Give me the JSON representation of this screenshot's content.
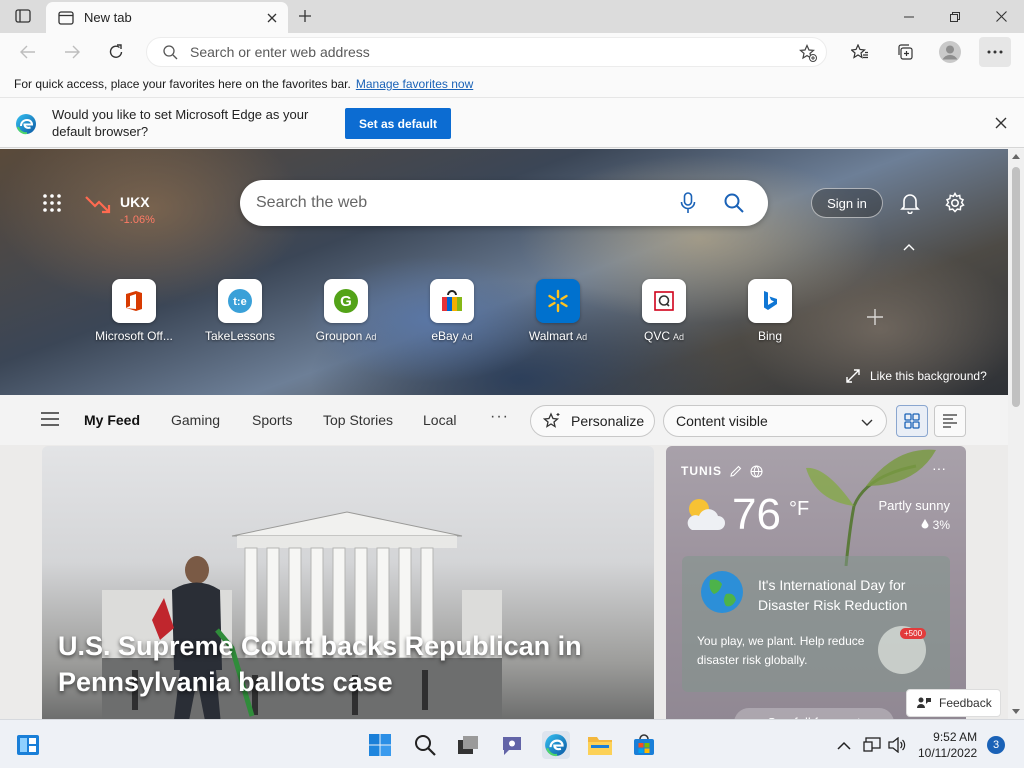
{
  "browser": {
    "tab_title": "New tab",
    "address_placeholder": "Search or enter web address"
  },
  "favorites_bar": {
    "hint": "For quick access, place your favorites here on the favorites bar.",
    "link": "Manage favorites now"
  },
  "default_prompt": {
    "message": "Would you like to set Microsoft Edge as your default browser?",
    "button": "Set as default"
  },
  "hero": {
    "stock": {
      "symbol": "UKX",
      "change": "-1.06%"
    },
    "search_placeholder": "Search the web",
    "sign_in": "Sign in",
    "like_background": "Like this background?",
    "tiles": [
      {
        "name": "Microsoft Off...",
        "ad": "",
        "icon": "office-icon"
      },
      {
        "name": "TakeLessons",
        "ad": "",
        "icon": "takelessons-icon"
      },
      {
        "name": "Groupon",
        "ad": "Ad",
        "icon": "groupon-icon"
      },
      {
        "name": "eBay",
        "ad": "Ad",
        "icon": "ebay-icon"
      },
      {
        "name": "Walmart",
        "ad": "Ad",
        "icon": "walmart-icon"
      },
      {
        "name": "QVC",
        "ad": "Ad",
        "icon": "qvc-icon"
      },
      {
        "name": "Bing",
        "ad": "",
        "icon": "bing-icon"
      }
    ]
  },
  "feed_nav": {
    "tabs": [
      "My Feed",
      "Gaming",
      "Sports",
      "Top Stories",
      "Local"
    ],
    "more": "···",
    "personalize": "Personalize",
    "content_visibility": "Content visible"
  },
  "news": {
    "headline": "U.S. Supreme Court backs Republican in Pennsylvania ballots case"
  },
  "weather": {
    "location": "TUNIS",
    "temperature": "76",
    "unit": "°F",
    "condition": "Partly sunny",
    "precipitation": "3%",
    "promo_title": "It's International Day for Disaster Risk Reduction",
    "promo_body": "You play, we plant. Help reduce disaster risk globally.",
    "promo_badge": "+500",
    "see_all": "See full forecast"
  },
  "feedback": "Feedback",
  "taskbar": {
    "time": "9:52 AM",
    "date": "10/11/2022",
    "notifications": "3"
  },
  "colors": {
    "accent": "#0c6cd2",
    "link": "#1a62b7",
    "stock_down": "#ff7b66"
  }
}
